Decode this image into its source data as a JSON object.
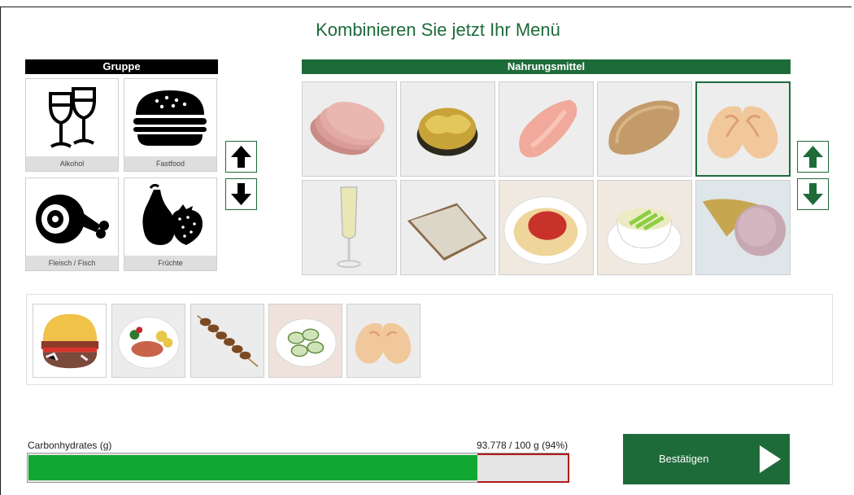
{
  "title": "Kombinieren Sie jetzt Ihr Menü",
  "group_panel": {
    "header": "Gruppe",
    "items": [
      {
        "label": "Alkohol",
        "icon": "wine-glasses-icon"
      },
      {
        "label": "Fastfood",
        "icon": "burger-icon"
      },
      {
        "label": "Fleisch / Fisch",
        "icon": "ham-icon"
      },
      {
        "label": "Früchte",
        "icon": "fruit-icon"
      }
    ],
    "scroll_up_icon": "arrow-up-icon",
    "scroll_down_icon": "arrow-down-icon"
  },
  "food_panel": {
    "header": "Nahrungsmittel",
    "items": [
      {
        "name": "ham-slices",
        "selected": false
      },
      {
        "name": "walnut",
        "selected": false
      },
      {
        "name": "chicken-breast",
        "selected": false
      },
      {
        "name": "breaded-schnitzel",
        "selected": false
      },
      {
        "name": "palmier-pastry",
        "selected": true
      },
      {
        "name": "sparkling-wine-glass",
        "selected": false
      },
      {
        "name": "bread-slice",
        "selected": false
      },
      {
        "name": "spaghetti-bolognese",
        "selected": false
      },
      {
        "name": "asparagus-soup",
        "selected": false
      },
      {
        "name": "ice-cream-cone",
        "selected": false
      }
    ]
  },
  "menu": {
    "items": [
      "burger",
      "fish-plate-with-vegetables",
      "meat-skewer",
      "cucumber-salad",
      "palmier-pastry"
    ]
  },
  "progress": {
    "label": "Carbonhydrates (g)",
    "value_text": "93.778 / 100 g (94%)",
    "fraction": 0.94,
    "fill_color": "#10a832",
    "limit_color": "#b01c1c"
  },
  "confirm_button": {
    "label": "Bestätigen",
    "icon": "play-arrow-icon"
  },
  "colors": {
    "accent": "#1e6b3a",
    "group_header": "#000000"
  }
}
